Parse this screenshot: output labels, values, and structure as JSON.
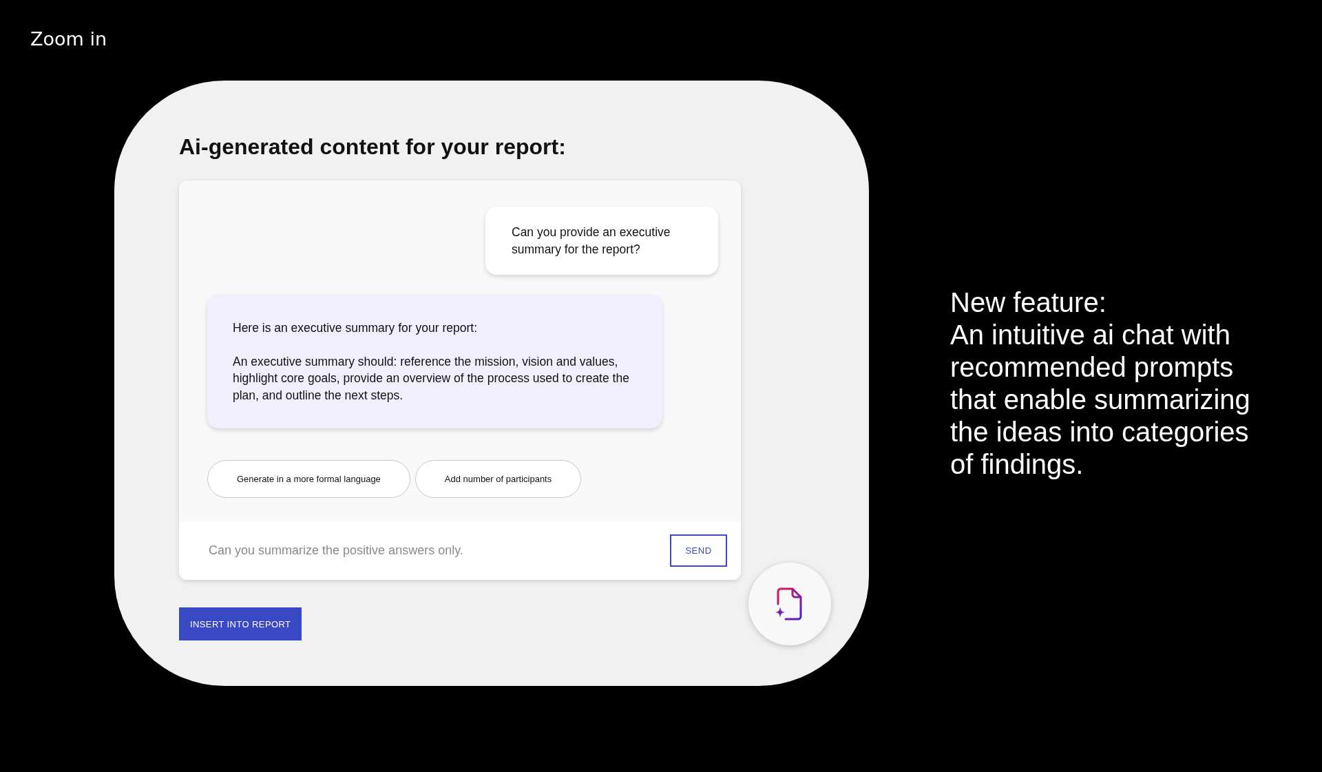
{
  "slide_title": "Zoom in",
  "screen": {
    "heading": "Ai-generated content for your report:",
    "messages": [
      {
        "kind": "user",
        "paragraphs": [
          "Can you provide an executive summary for the report?"
        ]
      },
      {
        "kind": "assistant",
        "paragraphs": [
          "Here is an executive summary for your report:",
          "An executive summary should: reference the mission, vision and values, highlight core goals, provide an overview of the process used to create the plan, and outline the next steps."
        ]
      }
    ],
    "suggestions": [
      "Generate in a more formal language",
      "Add number of participants"
    ],
    "input": {
      "placeholder": "Can you summarize the positive answers only."
    },
    "send_button": "SEND",
    "insert_button": "INSERT INTO REPORT"
  },
  "description": {
    "title": "New feature:",
    "body": "An intuitive ai chat with recommended prompts that enable summarizing the ideas into categories of findings."
  }
}
